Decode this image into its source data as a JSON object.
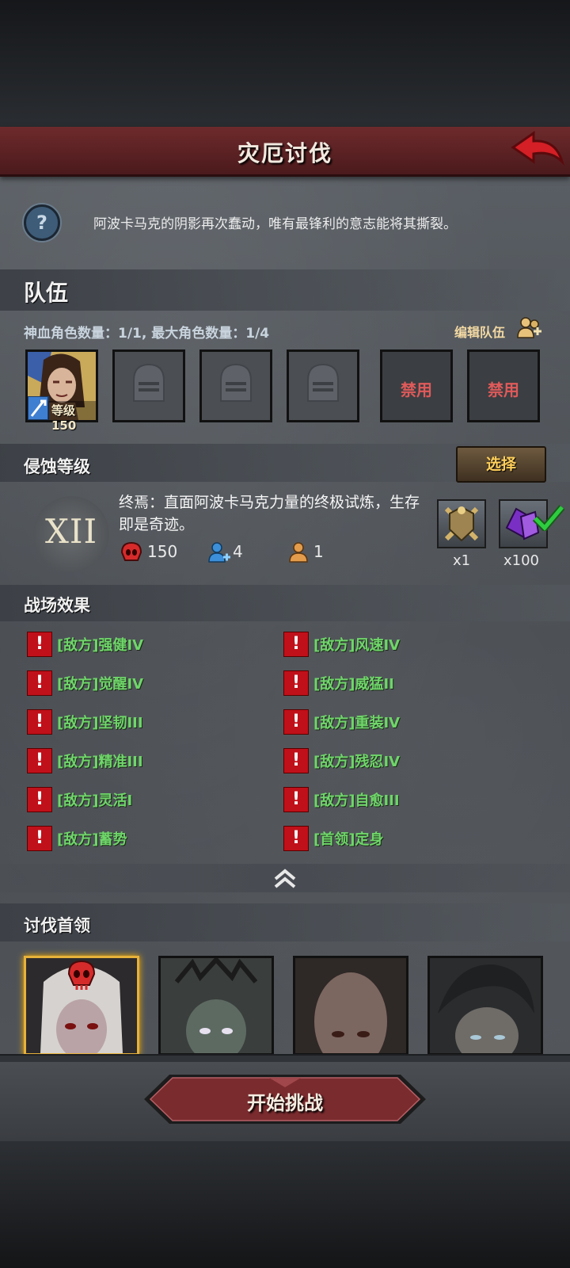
{
  "header": {
    "title": "灾厄讨伐"
  },
  "intro": {
    "description": "阿波卡马克的阴影再次蠢动，唯有最锋利的意志能将其撕裂。"
  },
  "team": {
    "section_title": "队伍",
    "info": "神血角色数量：1/1, 最大角色数量：1/4",
    "edit_label": "编辑队伍",
    "hero_level_label": "等级150",
    "banned_label_1": "禁用",
    "banned_label_2": "禁用"
  },
  "erosion": {
    "section_title": "侵蚀等级",
    "select_label": "选择",
    "level_numeral": "XII",
    "description": "终焉：直面阿波卡马克力量的终极试炼，生存即是奇迹。",
    "stat_enemy_level": "150",
    "stat_team_bonus": "4",
    "stat_player": "1",
    "reward_1_count": "x1",
    "reward_2_count": "x100"
  },
  "battlefield": {
    "section_title": "战场效果",
    "effects": [
      "[敌方]强健IV",
      "[敌方]风速IV",
      "[敌方]觉醒IV",
      "[敌方]威猛II",
      "[敌方]坚韧III",
      "[敌方]重装IV",
      "[敌方]精准III",
      "[敌方]残忍IV",
      "[敌方]灵活I",
      "[敌方]自愈III",
      "[敌方]蓄势",
      "[首领]定身"
    ]
  },
  "bosses": {
    "section_title": "讨伐首领"
  },
  "footer": {
    "start_label": "开始挑战"
  },
  "colors": {
    "effect_text": "#6fd66a",
    "warning_red": "#c0101a",
    "title_bar": "#6e2a2c",
    "select_text": "#ffcf5a",
    "boss_highlight": "#e7b13a"
  }
}
